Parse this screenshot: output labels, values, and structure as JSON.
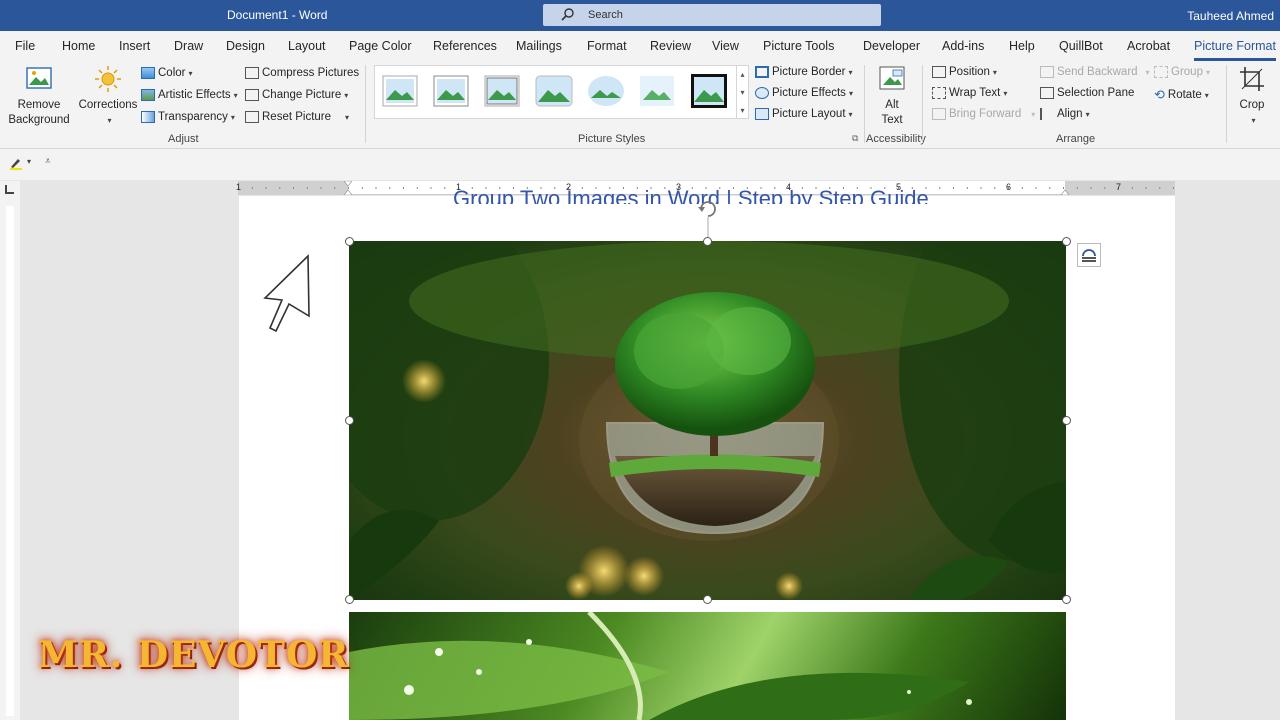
{
  "title_bar": {
    "doc_title": "Document1  -  Word",
    "search_label": "Search",
    "user_name": "Tauheed Ahmed"
  },
  "tabs": [
    "File",
    "Home",
    "Insert",
    "Draw",
    "Design",
    "Layout",
    "Page Color",
    "References",
    "Mailings",
    "Format",
    "Review",
    "View",
    "Picture Tools",
    "Developer",
    "Add-ins",
    "Help",
    "QuillBot",
    "Acrobat",
    "Picture Format"
  ],
  "active_tab": "Picture Format",
  "ribbon": {
    "remove_bg_1": "Remove",
    "remove_bg_2": "Background",
    "corrections": "Corrections",
    "color": "Color",
    "artistic_effects": "Artistic Effects",
    "transparency": "Transparency",
    "compress": "Compress Pictures",
    "change_picture": "Change Picture",
    "reset_picture": "Reset Picture",
    "adjust_label": "Adjust",
    "picture_border": "Picture Border",
    "picture_effects": "Picture Effects",
    "picture_layout": "Picture Layout",
    "picture_styles_label": "Picture Styles",
    "alt_text_1": "Alt",
    "alt_text_2": "Text",
    "accessibility_label": "Accessibility",
    "position": "Position",
    "wrap_text": "Wrap Text",
    "bring_forward": "Bring Forward",
    "send_backward": "Send Backward",
    "selection_pane": "Selection Pane",
    "align": "Align",
    "group": "Group",
    "rotate": "Rotate",
    "arrange_label": "Arrange",
    "crop": "Crop"
  },
  "ruler_numbers": [
    "1",
    "1",
    "2",
    "3",
    "4",
    "5",
    "6",
    "7"
  ],
  "document": {
    "heading": "Group Two Images in Word | Step by Step Guide"
  },
  "watermark": "MR. DEVOTOR",
  "colors": {
    "accent": "#2b579a",
    "watermark": "#f5b632"
  }
}
